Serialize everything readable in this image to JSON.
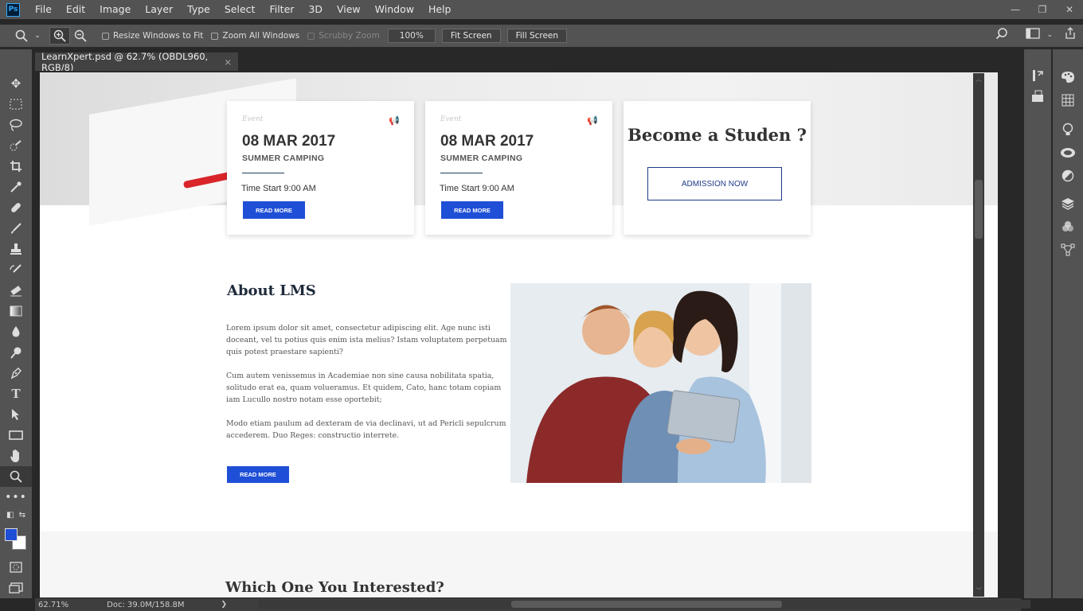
{
  "app": {
    "logo": "Ps"
  },
  "menu": [
    "File",
    "Edit",
    "Image",
    "Layer",
    "Type",
    "Select",
    "Filter",
    "3D",
    "View",
    "Window",
    "Help"
  ],
  "window_controls": {
    "minimize": "—",
    "restore": "❐",
    "close": "✕"
  },
  "options": {
    "resize_windows": "Resize Windows to Fit",
    "zoom_all": "Zoom All Windows",
    "scrubby": "Scrubby Zoom",
    "zoom_value": "100%",
    "fit_screen": "Fit Screen",
    "fill_screen": "Fill Screen"
  },
  "document": {
    "tab_title": "LearnXpert.psd @ 62.7% (OBDL960, RGB/8)",
    "close": "×"
  },
  "cards": [
    {
      "event": "Event",
      "date": "08 MAR 2017",
      "title": "SUMMER CAMPING",
      "time": "Time Start 9:00 AM",
      "button": "READ MORE"
    },
    {
      "event": "Event",
      "date": "08 MAR 2017",
      "title": "SUMMER CAMPING",
      "time": "Time Start 9:00 AM",
      "button": "READ MORE"
    }
  ],
  "cta": {
    "title": "Become a Studen ?",
    "button": "ADMISSION NOW"
  },
  "about": {
    "title": "About LMS",
    "p1": "Lorem ipsum dolor sit amet, consectetur adipiscing elit. Age nunc isti doceant, vel tu potius quis enim ista melius? Istam voluptatem perpetuam quis potest praestare sapienti?",
    "p2": "Cum autem venissemus in Academiae non sine causa nobilitata spatia, solitudo erat ea, quam volueramus. Et quidem, Cato, hanc totam copiam iam Lucullo nostro notam esse oportebit;",
    "p3": "Modo etiam paulum ad dexteram de via declinavi, ut ad Pericli sepulcrum accederem. Duo Reges: constructio interrete.",
    "button": "READ MORE"
  },
  "section2": {
    "title": "Which One You Interested?"
  },
  "status": {
    "zoom": "62.71%",
    "doc": "Doc: 39.0M/158.8M",
    "arrow": "❯"
  },
  "colors": {
    "foreground": "#1f4fd6",
    "background": "#ffffff",
    "accent": "#1f4fd6",
    "ui_panel": "#535353"
  }
}
